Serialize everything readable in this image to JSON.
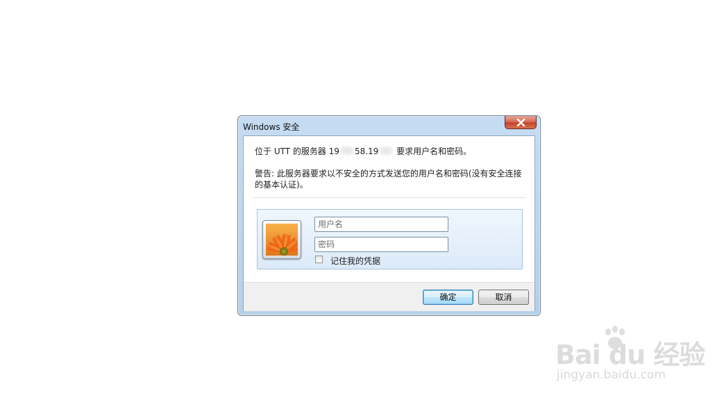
{
  "window": {
    "title": "Windows 安全",
    "close_icon": "close-x-icon"
  },
  "message": {
    "line1_prefix": "位于 UTT 的服务器 19",
    "line1_mid": "58.19",
    "line1_suffix": "要求用户名和密码。",
    "warning": "警告: 此服务器要求以不安全的方式发送您的用户名和密码(没有安全连接的基本认证)。"
  },
  "credentials": {
    "avatar_icon": "user-flower-icon",
    "username_placeholder": "用户名",
    "password_placeholder": "密码",
    "remember_label": "记住我的凭据",
    "remember_checked": false
  },
  "buttons": {
    "ok_label": "确定",
    "cancel_label": "取消"
  },
  "watermark": {
    "logo_text": "Bai du 经验",
    "url": "jingyan.baidu.com"
  }
}
